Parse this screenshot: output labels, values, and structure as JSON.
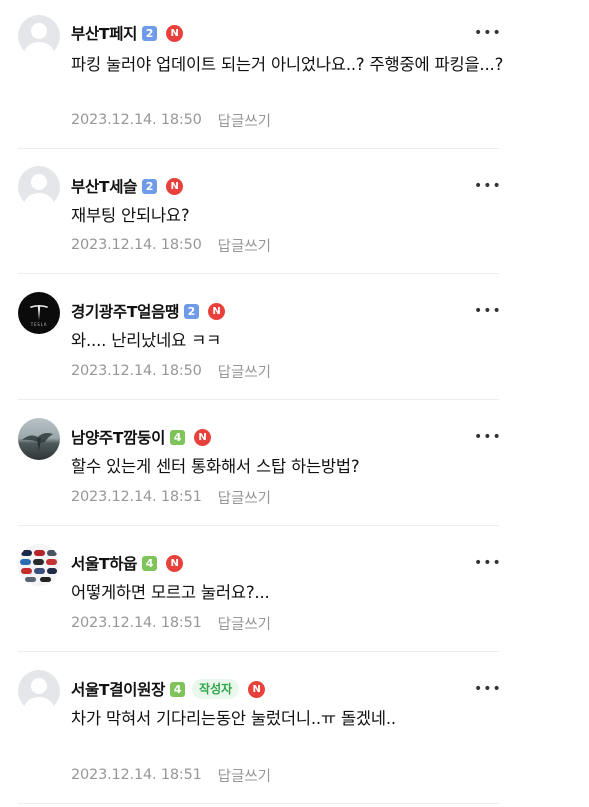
{
  "comments": [
    {
      "author": "부산T페지",
      "level": "2",
      "n_badge": "N",
      "text": "파킹 눌러야 업데이트 되는거 아니었나요..? 주행중에 파킹을...?",
      "time": "2023.12.14. 18:50",
      "reply_label": "답글쓰기",
      "avatar": "default-profile"
    },
    {
      "author": "부산T세슬",
      "level": "2",
      "n_badge": "N",
      "text": "재부팅 안되나요?",
      "time": "2023.12.14. 18:50",
      "reply_label": "답글쓰기",
      "avatar": "default-profile"
    },
    {
      "author": "경기광주T얼음땡",
      "level": "2",
      "n_badge": "N",
      "text": "와.... 난리났네요 ㅋㅋ",
      "time": "2023.12.14. 18:50",
      "reply_label": "답글쓰기",
      "avatar": "tesla-logo",
      "avatar_caption": "TESLA"
    },
    {
      "author": "남양주T깜둥이",
      "level": "4",
      "n_badge": "N",
      "text": "할수 있는게 센터 통화해서 스탑 하는방법?",
      "time": "2023.12.14. 18:51",
      "reply_label": "답글쓰기",
      "avatar": "landscape-photo"
    },
    {
      "author": "서울T하웁",
      "level": "4",
      "n_badge": "N",
      "text": "어떻게하면 모르고 눌러요?...",
      "time": "2023.12.14. 18:51",
      "reply_label": "답글쓰기",
      "avatar": "cars-photo"
    },
    {
      "author": "서울T결이원장",
      "level": "4",
      "writer_badge": "작성자",
      "n_badge": "N",
      "text": "차가 막혀서 기다리는동안 눌렀더니..ㅠ 돌겠네..",
      "time": "2023.12.14. 18:51",
      "reply_label": "답글쓰기",
      "avatar": "default-profile"
    }
  ],
  "more_label": "•••",
  "colors": {
    "level_blue": "#6f9be8",
    "level_green": "#7fc45a",
    "n_badge": "#e8413b",
    "writer_badge_text": "#2fa64a",
    "meta_gray": "#979797"
  }
}
